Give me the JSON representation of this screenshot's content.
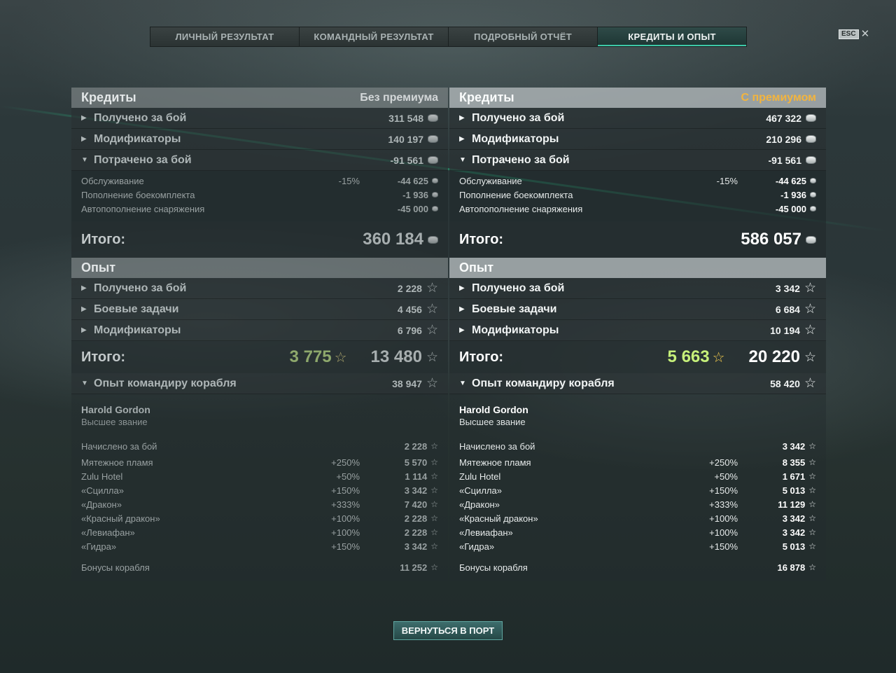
{
  "tabs": [
    {
      "label": "ЛИЧНЫЙ РЕЗУЛЬТАТ"
    },
    {
      "label": "КОМАНДНЫЙ РЕЗУЛЬТАТ"
    },
    {
      "label": "ПОДРОБНЫЙ ОТЧЁТ"
    },
    {
      "label": "КРЕДИТЫ И ОПЫТ"
    }
  ],
  "esc": {
    "key": "ESC",
    "close": "✕"
  },
  "left": {
    "credits_title": "Кредиты",
    "credits_sub": "Без премиума",
    "received": {
      "label": "Получено за бой",
      "value": "311 548"
    },
    "modifiers": {
      "label": "Модификаторы",
      "value": "140 197"
    },
    "spent": {
      "label": "Потрачено за бой",
      "value": "-91 561"
    },
    "service": {
      "label": "Обслуживание",
      "pct": "-15%",
      "value": "-44 625"
    },
    "ammo": {
      "label": "Пополнение боекомплекта",
      "value": "-1 936"
    },
    "consumables": {
      "label": "Автопополнение снаряжения",
      "value": "-45 000"
    },
    "credits_total": {
      "label": "Итого:",
      "value": "360 184"
    },
    "xp_title": "Опыт",
    "xp_received": {
      "label": "Получено за бой",
      "value": "2 228"
    },
    "xp_tasks": {
      "label": "Боевые задачи",
      "value": "4 456"
    },
    "xp_modifiers": {
      "label": "Модификаторы",
      "value": "6 796"
    },
    "xp_total": {
      "label": "Итого:",
      "green": "3 775",
      "value": "13 480"
    },
    "commander": {
      "label": "Опыт командиру корабля",
      "value": "38 947"
    },
    "cmd_name": "Harold Gordon",
    "cmd_rank": "Высшее звание",
    "accrued": {
      "label": "Начислено за бой",
      "value": "2 228"
    },
    "flags": [
      {
        "label": "Мятежное пламя",
        "pct": "+250%",
        "value": "5 570"
      },
      {
        "label": "Zulu Hotel",
        "pct": "+50%",
        "value": "1 114"
      },
      {
        "label": "«Сцилла»",
        "pct": "+150%",
        "value": "3 342"
      },
      {
        "label": "«Дракон»",
        "pct": "+333%",
        "value": "7 420"
      },
      {
        "label": "«Красный дракон»",
        "pct": "+100%",
        "value": "2 228"
      },
      {
        "label": "«Левиафан»",
        "pct": "+100%",
        "value": "2 228"
      },
      {
        "label": "«Гидра»",
        "pct": "+150%",
        "value": "3 342"
      }
    ],
    "ship_bonus": {
      "label": "Бонусы корабля",
      "value": "11 252"
    }
  },
  "right": {
    "credits_title": "Кредиты",
    "credits_sub": "С премиумом",
    "received": {
      "label": "Получено за бой",
      "value": "467 322"
    },
    "modifiers": {
      "label": "Модификаторы",
      "value": "210 296"
    },
    "spent": {
      "label": "Потрачено за бой",
      "value": "-91 561"
    },
    "service": {
      "label": "Обслуживание",
      "pct": "-15%",
      "value": "-44 625"
    },
    "ammo": {
      "label": "Пополнение боекомплекта",
      "value": "-1 936"
    },
    "consumables": {
      "label": "Автопополнение снаряжения",
      "value": "-45 000"
    },
    "credits_total": {
      "label": "Итого:",
      "value": "586 057"
    },
    "xp_title": "Опыт",
    "xp_received": {
      "label": "Получено за бой",
      "value": "3 342"
    },
    "xp_tasks": {
      "label": "Боевые задачи",
      "value": "6 684"
    },
    "xp_modifiers": {
      "label": "Модификаторы",
      "value": "10 194"
    },
    "xp_total": {
      "label": "Итого:",
      "green": "5 663",
      "value": "20 220"
    },
    "commander": {
      "label": "Опыт командиру корабля",
      "value": "58 420"
    },
    "cmd_name": "Harold Gordon",
    "cmd_rank": "Высшее звание",
    "accrued": {
      "label": "Начислено за бой",
      "value": "3 342"
    },
    "flags": [
      {
        "label": "Мятежное пламя",
        "pct": "+250%",
        "value": "8 355"
      },
      {
        "label": "Zulu Hotel",
        "pct": "+50%",
        "value": "1 671"
      },
      {
        "label": "«Сцилла»",
        "pct": "+150%",
        "value": "5 013"
      },
      {
        "label": "«Дракон»",
        "pct": "+333%",
        "value": "11 129"
      },
      {
        "label": "«Красный дракон»",
        "pct": "+100%",
        "value": "3 342"
      },
      {
        "label": "«Левиафан»",
        "pct": "+100%",
        "value": "3 342"
      },
      {
        "label": "«Гидра»",
        "pct": "+150%",
        "value": "5 013"
      }
    ],
    "ship_bonus": {
      "label": "Бонусы корабля",
      "value": "16 878"
    }
  },
  "return_button": "ВЕРНУТЬСЯ В ПОРТ",
  "icons": {
    "credits": "coin-stack-icon",
    "xp": "star-icon",
    "collapsed": "triangle-right-icon",
    "expanded": "triangle-down-icon"
  },
  "colors": {
    "premium_accent": "#f3b43d",
    "xp_green": "#c6f07a",
    "tab_active": "#3ec9a8"
  }
}
